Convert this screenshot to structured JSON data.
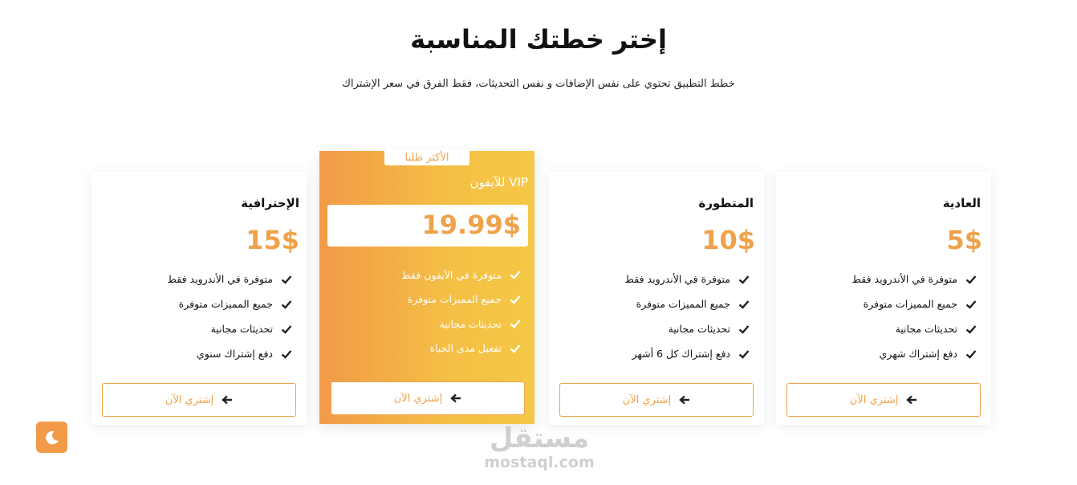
{
  "header": {
    "title": "إختر خطتك المناسبة",
    "subtitle": "خطط التطبيق تحتوي على نفس الإضافات و نفس التحديثات، فقط الفرق في سعر الإشتراك"
  },
  "colors": {
    "accent": "#f0a24a",
    "gradient_start": "#f29a48",
    "gradient_end": "#f5c846"
  },
  "plans": {
    "basic": {
      "name": "العادية",
      "price": "5$",
      "features": [
        "متوفرة في الأندرويد فقط",
        "جميع المميزات متوفرة",
        "تحديثات مجانية",
        "دفع إشتراك شهري"
      ],
      "button": "إشتري الآن"
    },
    "advanced": {
      "name": "المتطورة",
      "price": "10$",
      "features": [
        "متوفرة في الأندرويد فقط",
        "جميع المميزات متوفرة",
        "تحديثات مجانية",
        "دفع إشتراك كل 6 أشهر"
      ],
      "button": "إشتري الآن"
    },
    "vip": {
      "badge": "الأكثر طلبا",
      "name": "VIP للآيفون",
      "price": "19.99$",
      "features": [
        "متوفرة في الآيفون فقط",
        "جميع المميزات متوفرة",
        "تحديثات مجانية",
        "تفعيل مدى الحياة"
      ],
      "button": "إشتري الآن"
    },
    "pro": {
      "name": "الإحترافية",
      "price": "15$",
      "features": [
        "متوفرة في الأندرويد فقط",
        "جميع المميزات متوفرة",
        "تحديثات مجانية",
        "دفع إشتراك سنوي"
      ],
      "button": "إشتري الآن"
    }
  },
  "theme_toggle": {
    "icon": "moon-icon"
  },
  "watermark": {
    "arabic": "مستقل",
    "latin": "mostaql.com"
  }
}
